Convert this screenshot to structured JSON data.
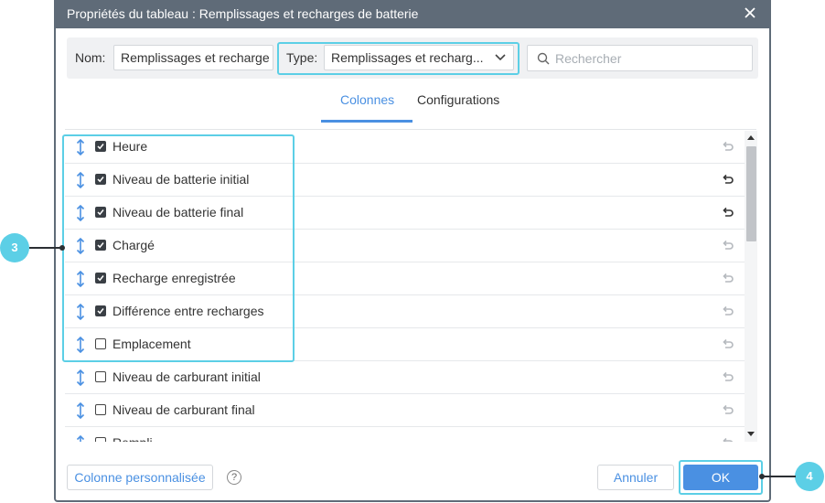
{
  "dialog": {
    "title": "Propriétés du tableau : Remplissages et recharges de batterie",
    "close_icon": "close-icon"
  },
  "toolbar": {
    "name_label": "Nom:",
    "name_value": "Remplissages et recharge",
    "type_label": "Type:",
    "type_value": "Remplissages et recharg...",
    "search_placeholder": "Rechercher"
  },
  "tabs": [
    {
      "label": "Colonnes",
      "active": true
    },
    {
      "label": "Configurations",
      "active": false
    }
  ],
  "columns": [
    {
      "label": "Heure",
      "checked": true,
      "reset_active": false
    },
    {
      "label": "Niveau de batterie initial",
      "checked": true,
      "reset_active": true
    },
    {
      "label": "Niveau de batterie final",
      "checked": true,
      "reset_active": true
    },
    {
      "label": "Chargé",
      "checked": true,
      "reset_active": false
    },
    {
      "label": "Recharge enregistrée",
      "checked": true,
      "reset_active": false
    },
    {
      "label": "Différence entre recharges",
      "checked": true,
      "reset_active": false
    },
    {
      "label": "Emplacement",
      "checked": false,
      "reset_active": false
    },
    {
      "label": "Niveau de carburant initial",
      "checked": false,
      "reset_active": false
    },
    {
      "label": "Niveau de carburant final",
      "checked": false,
      "reset_active": false
    },
    {
      "label": "Rempli",
      "checked": false,
      "reset_active": false
    }
  ],
  "footer": {
    "custom_column_label": "Colonne personnalisée",
    "help_label": "?",
    "cancel_label": "Annuler",
    "ok_label": "OK"
  },
  "callouts": {
    "left": "3",
    "right": "4"
  },
  "colors": {
    "accent": "#4a90e2",
    "highlight": "#5ccfe6",
    "titlebar": "#5f6b78"
  }
}
